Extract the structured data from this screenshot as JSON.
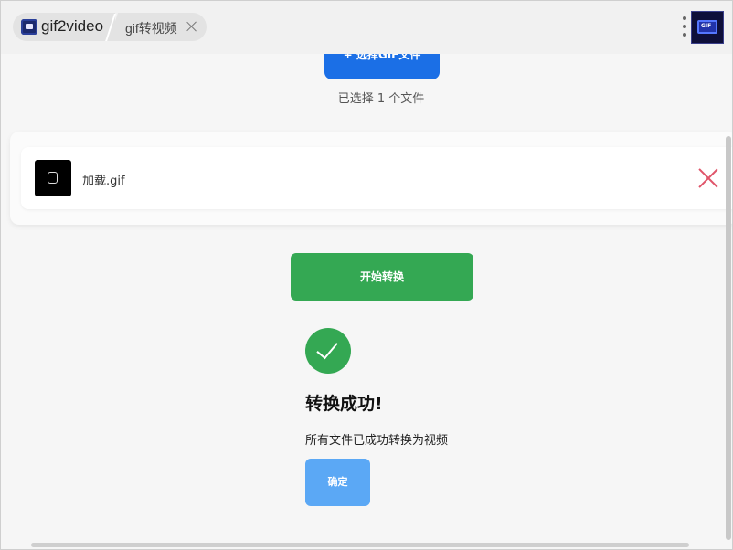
{
  "window": {
    "app_tab_label": "gif2video",
    "page_tab_label": "gif转视频",
    "avatar_badge": "GIF"
  },
  "upload": {
    "button_label": "+ 选择GIF文件",
    "selected_count": "已选择 1 个文件"
  },
  "files": [
    {
      "name": "加载.gif"
    }
  ],
  "actions": {
    "start_label": "开始转换",
    "confirm_label": "确定"
  },
  "result": {
    "title": "转换成功!",
    "message": "所有文件已成功转换为视频"
  },
  "colors": {
    "upload_button": "#1b6fe6",
    "start_button": "#34a853",
    "success_icon": "#34a853",
    "confirm_button": "#5ba8f5",
    "remove_icon": "#e0556a"
  },
  "icons": {
    "app": "gif2video-app-icon",
    "tab_close": "close-icon",
    "menu": "more-vertical-icon",
    "file_thumb": "gif-thumbnail-icon",
    "file_remove": "close-icon",
    "success": "check-circle-icon"
  }
}
